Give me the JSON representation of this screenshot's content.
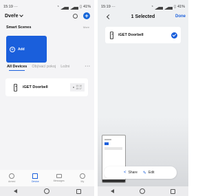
{
  "left": {
    "status": {
      "time": "15:19",
      "extra": "···",
      "battery": "41%"
    },
    "header": {
      "title": "Dveře",
      "add_symbol": "+"
    },
    "scenes": {
      "title": "Smart Scenes",
      "more": "More",
      "add_label": "Add",
      "add_symbol": "+"
    },
    "tabs": [
      {
        "label": "All Devices"
      },
      {
        "label": "Obývací pokoj"
      },
      {
        "label": "Ložni"
      }
    ],
    "tabs_more": "···",
    "device": {
      "name": "iGET Doorbell",
      "time_line1": "10:16",
      "time_line2": "15:17"
    },
    "tabbar": [
      {
        "label": "Armed"
      },
      {
        "label": "Device"
      },
      {
        "label": "Messages"
      },
      {
        "label": "My"
      }
    ]
  },
  "right": {
    "status": {
      "time": "15:19",
      "extra": "···",
      "battery": "41%"
    },
    "title": "1 Selected",
    "done": "Done",
    "device": {
      "name": "iGET Doorbell"
    },
    "actions": {
      "share": "Share",
      "edit": "Edit"
    },
    "share_icon_glyph": "<",
    "edit_icon_glyph": "✎"
  },
  "colors": {
    "accent": "#1a5fdc",
    "background": "#f4f4f6"
  }
}
